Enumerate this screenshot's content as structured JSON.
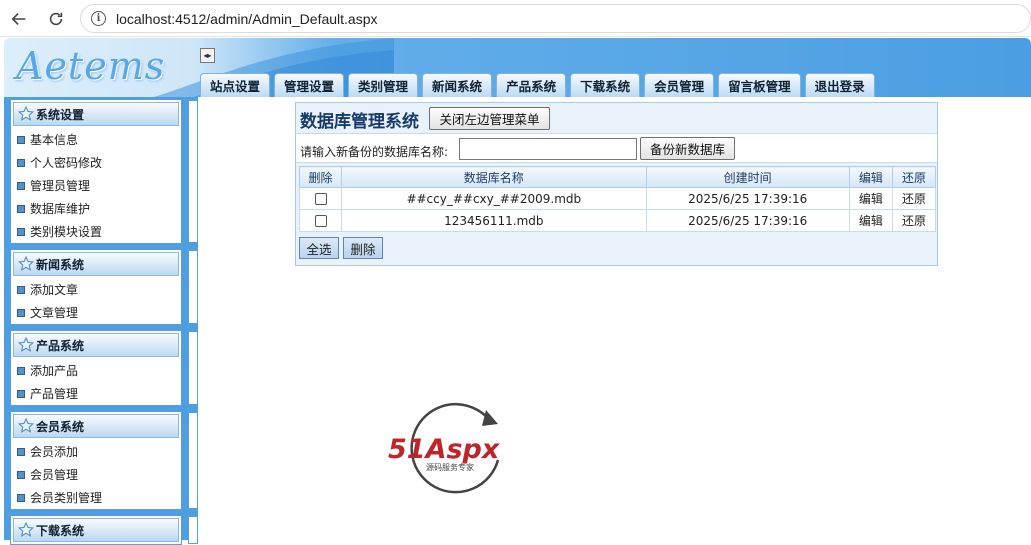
{
  "browser": {
    "url": "localhost:4512/admin/Admin_Default.aspx"
  },
  "header": {
    "logo": "Aetems",
    "toggle": "◂▸",
    "tabs": [
      "站点设置",
      "管理设置",
      "类别管理",
      "新闻系统",
      "产品系统",
      "下载系统",
      "会员管理",
      "留言板管理",
      "退出登录"
    ]
  },
  "sidebar": {
    "groups": [
      {
        "title": "系统设置",
        "items": [
          "基本信息",
          "个人密码修改",
          "管理员管理",
          "数据库维护",
          "类别模块设置"
        ]
      },
      {
        "title": "新闻系统",
        "items": [
          "添加文章",
          "文章管理"
        ]
      },
      {
        "title": "产品系统",
        "items": [
          "添加产品",
          "产品管理"
        ]
      },
      {
        "title": "会员系统",
        "items": [
          "会员添加",
          "会员管理",
          "会员类别管理"
        ]
      },
      {
        "title": "下载系统",
        "items": []
      }
    ]
  },
  "main": {
    "title": "数据库管理系统",
    "close_menu_label": "关闭左边管理菜单",
    "backup_name_label": "请输入新备份的数据库名称:",
    "backup_name_value": "",
    "backup_button": "备份新数据库",
    "table": {
      "headers": [
        "删除",
        "数据库名称",
        "创建时间",
        "编辑",
        "还原"
      ],
      "rows": [
        {
          "name": "##ccy_##cxy_##2009.mdb",
          "time": "2025/6/25 17:39:16",
          "edit": "编辑",
          "restore": "还原"
        },
        {
          "name": "123456111.mdb",
          "time": "2025/6/25 17:39:16",
          "edit": "编辑",
          "restore": "还原"
        }
      ]
    },
    "select_all": "全选",
    "delete": "删除"
  },
  "watermark": {
    "brand": "51Aspx",
    "slogan": "源码服务专家"
  }
}
